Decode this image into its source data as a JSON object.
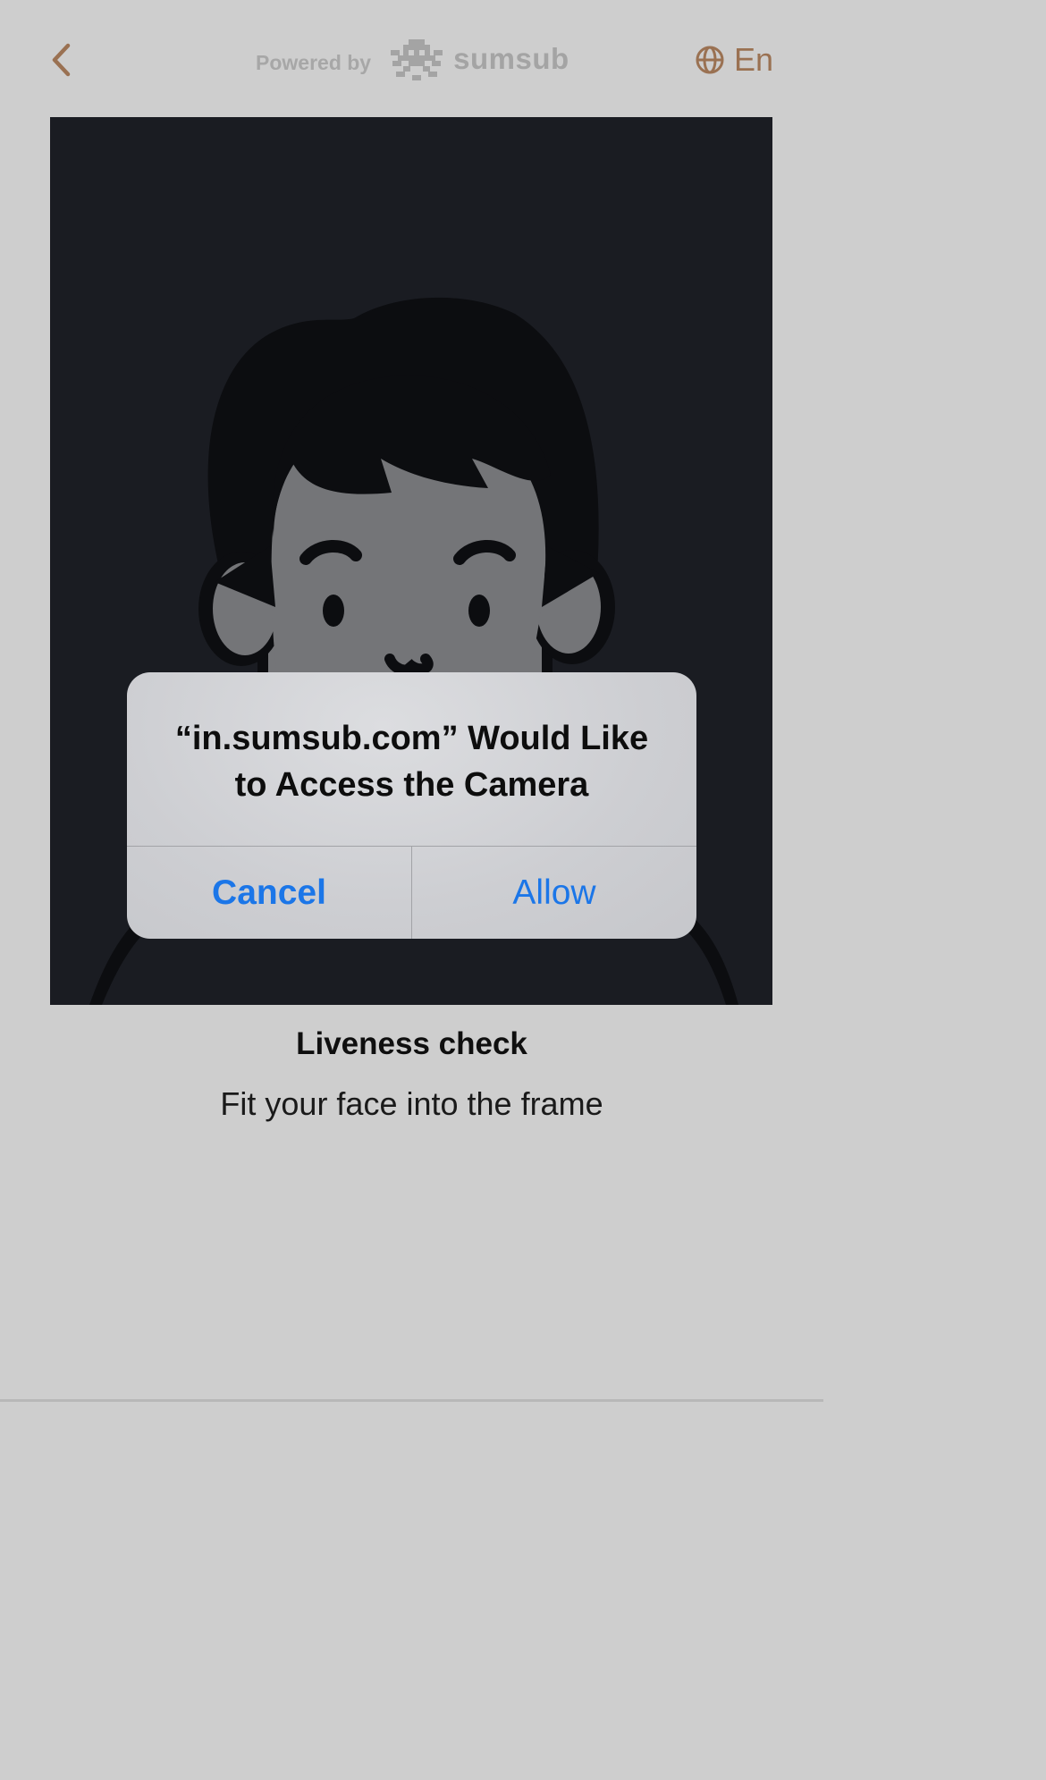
{
  "header": {
    "back_icon": "chevron-left-icon",
    "powered_by_label": "Powered by",
    "brand_name": "sumsub",
    "language_icon": "globe-icon",
    "language_label": "En"
  },
  "camera_prompt": {
    "title": "“in.sumsub.com” Would Like\nto Access the Camera",
    "cancel_label": "Cancel",
    "allow_label": "Allow"
  },
  "caption": {
    "title": "Liveness check",
    "subtitle": "Fit your face into the frame"
  },
  "colors": {
    "background": "#cecece",
    "accent": "#9a7152",
    "frame": "#1a1c22",
    "dialog_button": "#1b76e8"
  }
}
